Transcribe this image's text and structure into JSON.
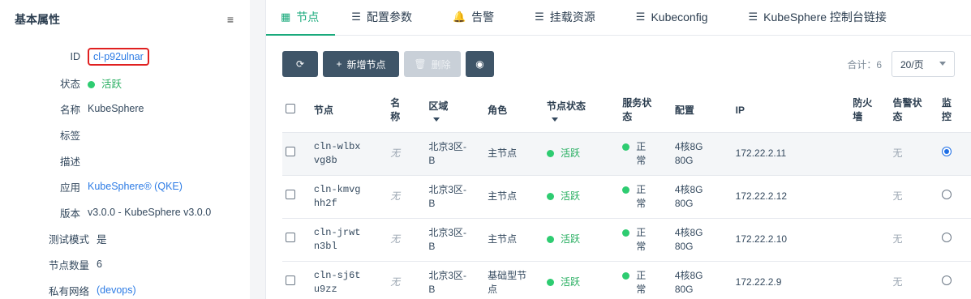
{
  "sidebar": {
    "title": "基本属性",
    "menu_icon": "≡",
    "props": [
      {
        "label": "ID",
        "value": "cl-p92ulnar",
        "style": "id"
      },
      {
        "label": "状态",
        "value": "活跃",
        "style": "status"
      },
      {
        "label": "名称",
        "value": "KubeSphere",
        "style": "plain"
      },
      {
        "label": "标签",
        "value": "",
        "style": "plain"
      },
      {
        "label": "描述",
        "value": "",
        "style": "plain"
      },
      {
        "label": "应用",
        "value": "KubeSphere® (QKE)",
        "style": "link"
      },
      {
        "label": "版本",
        "value": "v3.0.0 - KubeSphere v3.0.0",
        "style": "plain"
      },
      {
        "label": "测试模式",
        "value": "是",
        "style": "wide"
      },
      {
        "label": "节点数量",
        "value": "6",
        "style": "wide"
      },
      {
        "label": "私有网络",
        "value": "(devops)",
        "style": "widelink"
      }
    ]
  },
  "tabs": [
    {
      "label": "节点",
      "icon": "grid-icon",
      "glyph": "▦",
      "active": true
    },
    {
      "label": "配置参数",
      "icon": "list-icon",
      "glyph": "☰",
      "active": false
    },
    {
      "label": "告警",
      "icon": "bell-icon",
      "glyph": "🔔",
      "active": false
    },
    {
      "label": "挂载资源",
      "icon": "list-icon",
      "glyph": "☰",
      "active": false
    },
    {
      "label": "Kubeconfig",
      "icon": "list-icon",
      "glyph": "☰",
      "active": false
    },
    {
      "label": "KubeSphere 控制台链接",
      "icon": "list-icon",
      "glyph": "☰",
      "active": false
    }
  ],
  "toolbar": {
    "refresh_icon": "⟳",
    "add_label": "新增节点",
    "add_icon": "+",
    "delete_label": "删除",
    "delete_icon": "🗑",
    "eye_icon": "◉",
    "total": "合计：6",
    "page_size": "20/页"
  },
  "table": {
    "headers": {
      "node": "节点",
      "name": "名称",
      "zone": "区域",
      "role": "角色",
      "node_status": "节点状态",
      "service_status": "服务状态",
      "config": "配置",
      "ip": "IP",
      "firewall": "防火墙",
      "alarm_status": "告警状态",
      "monitor": "监控"
    },
    "rows": [
      {
        "node": "cln-wlbxvg8b",
        "name": "无",
        "zone": "北京3区-B",
        "role": "主节点",
        "node_status": "活跃",
        "service_status": "正常",
        "config": "4核8G 80G",
        "ip": "172.22.2.11",
        "firewall": "",
        "alarm": "无",
        "monitor_selected": true
      },
      {
        "node": "cln-kmvghh2f",
        "name": "无",
        "zone": "北京3区-B",
        "role": "主节点",
        "node_status": "活跃",
        "service_status": "正常",
        "config": "4核8G 80G",
        "ip": "172.22.2.12",
        "firewall": "",
        "alarm": "无",
        "monitor_selected": false
      },
      {
        "node": "cln-jrwtn3bl",
        "name": "无",
        "zone": "北京3区-B",
        "role": "主节点",
        "node_status": "活跃",
        "service_status": "正常",
        "config": "4核8G 80G",
        "ip": "172.22.2.10",
        "firewall": "",
        "alarm": "无",
        "monitor_selected": false
      },
      {
        "node": "cln-sj6tu9zz",
        "name": "无",
        "zone": "北京3区-B",
        "role": "基础型节点",
        "node_status": "活跃",
        "service_status": "正常",
        "config": "4核8G 80G",
        "ip": "172.22.2.9",
        "firewall": "",
        "alarm": "无",
        "monitor_selected": false
      }
    ]
  },
  "colors": {
    "accent": "#1aaa7c",
    "link": "#2c7be5",
    "status_green": "#2ecc71",
    "highlight_box": "#e02020",
    "button_dark": "#3f5568"
  }
}
